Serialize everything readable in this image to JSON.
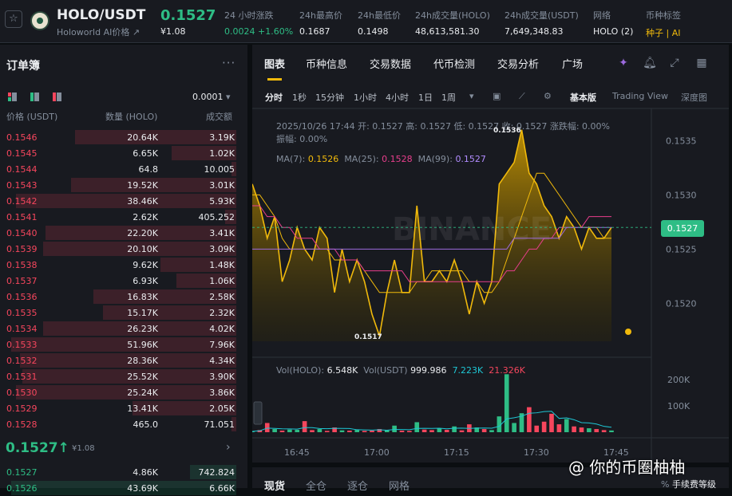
{
  "header": {
    "pair": "HOLO/USDT",
    "pair_sub": "Holoworld AI价格",
    "last_price": "0.1527",
    "last_fiat": "¥1.08",
    "stats": [
      {
        "label": "24 小时涨跌",
        "value": "0.0024 +1.60%"
      },
      {
        "label": "24h最高价",
        "value": "0.1687"
      },
      {
        "label": "24h最低价",
        "value": "0.1498"
      },
      {
        "label": "24h成交量(HOLO)",
        "value": "48,613,581.30"
      },
      {
        "label": "24h成交量(USDT)",
        "value": "7,649,348.83"
      },
      {
        "label": "网络",
        "value": "HOLO (2)"
      },
      {
        "label": "币种标签",
        "value": "种子 | AI"
      }
    ]
  },
  "orderbook": {
    "title": "订单簿",
    "tick": "0.0001",
    "col_price": "价格 (USDT)",
    "col_qty": "数量 (HOLO)",
    "col_total": "成交额",
    "asks": [
      {
        "p": "0.1546",
        "q": "20.64K",
        "t": "3.19K",
        "depth": 0.7
      },
      {
        "p": "0.1545",
        "q": "6.65K",
        "t": "1.02K",
        "depth": 0.28
      },
      {
        "p": "0.1544",
        "q": "64.8",
        "t": "10.005",
        "depth": 0.02
      },
      {
        "p": "0.1543",
        "q": "19.52K",
        "t": "3.01K",
        "depth": 0.72
      },
      {
        "p": "0.1542",
        "q": "38.46K",
        "t": "5.93K",
        "depth": 0.96
      },
      {
        "p": "0.1541",
        "q": "2.62K",
        "t": "405.252",
        "depth": 0.05
      },
      {
        "p": "0.1540",
        "q": "22.20K",
        "t": "3.41K",
        "depth": 0.83
      },
      {
        "p": "0.1539",
        "q": "20.10K",
        "t": "3.09K",
        "depth": 0.84
      },
      {
        "p": "0.1538",
        "q": "9.62K",
        "t": "1.48K",
        "depth": 0.33
      },
      {
        "p": "0.1537",
        "q": "6.93K",
        "t": "1.06K",
        "depth": 0.26
      },
      {
        "p": "0.1536",
        "q": "16.83K",
        "t": "2.58K",
        "depth": 0.62
      },
      {
        "p": "0.1535",
        "q": "15.17K",
        "t": "2.32K",
        "depth": 0.58
      },
      {
        "p": "0.1534",
        "q": "26.23K",
        "t": "4.02K",
        "depth": 0.84
      },
      {
        "p": "0.1533",
        "q": "51.96K",
        "t": "7.96K",
        "depth": 0.98
      },
      {
        "p": "0.1532",
        "q": "28.36K",
        "t": "4.34K",
        "depth": 0.94
      },
      {
        "p": "0.1531",
        "q": "25.52K",
        "t": "3.90K",
        "depth": 0.93
      },
      {
        "p": "0.1530",
        "q": "25.24K",
        "t": "3.86K",
        "depth": 0.96
      },
      {
        "p": "0.1529",
        "q": "13.41K",
        "t": "2.05K",
        "depth": 0.45
      },
      {
        "p": "0.1528",
        "q": "465.0",
        "t": "71.051",
        "depth": 0.02
      }
    ],
    "mid_price": "0.1527↑",
    "mid_fiat": "¥1.08",
    "bids": [
      {
        "p": "0.1527",
        "q": "4.86K",
        "t": "742.824",
        "depth": 0.2
      },
      {
        "p": "0.1526",
        "q": "43.69K",
        "t": "6.66K",
        "depth": 0.98
      }
    ]
  },
  "chart_panel": {
    "tabs": [
      "图表",
      "币种信息",
      "交易数据",
      "代币检测",
      "交易分析",
      "广场"
    ],
    "timeframes": [
      "分时",
      "1秒",
      "15分钟",
      "1小时",
      "4小时",
      "1日",
      "1周"
    ],
    "views": [
      "基本版",
      "Trading View",
      "深度图"
    ],
    "ohlc_line": "2025/10/26 17:44 开: 0.1527 高: 0.1527 低: 0.1527 收: 0.1527 涨跌幅: 0.00%",
    "ohlc_line2": "振幅: 0.00%",
    "ma_line": {
      "ma7_label": "MA(7):",
      "ma7": "0.1526",
      "ma25_label": "MA(25):",
      "ma25": "0.1528",
      "ma99_label": "MA(99):",
      "ma99": "0.1527"
    },
    "vol_line": {
      "label": "Vol(HOLO):",
      "holo": "6.548K",
      "usdt_label": "Vol(USDT)",
      "usdt": "999.986",
      "v1": "7.223K",
      "v2": "21.326K"
    },
    "current_price": "0.1527",
    "high_marker": "0.1536",
    "low_marker": "0.1517",
    "watermark": "BINANCE"
  },
  "chart_data": {
    "type": "area",
    "y_ticks": [
      "0.1535",
      "0.1530",
      "0.1525",
      "0.1520"
    ],
    "y_range": [
      0.15165,
      0.15365
    ],
    "x_ticks": [
      "16:45",
      "17:00",
      "17:15",
      "17:30",
      "17:45"
    ],
    "price": [
      0.1531,
      0.1529,
      0.1526,
      0.1528,
      0.1522,
      0.1524,
      0.1527,
      0.1525,
      0.1524,
      0.1527,
      0.1526,
      0.1521,
      0.1525,
      0.1522,
      0.1524,
      0.1522,
      0.1519,
      0.1517,
      0.1521,
      0.1524,
      0.1521,
      0.1521,
      0.1529,
      0.1522,
      0.1522,
      0.1523,
      0.1522,
      0.1524,
      0.1522,
      0.1519,
      0.1522,
      0.152,
      0.1522,
      0.1531,
      0.1532,
      0.1533,
      0.1536,
      0.1532,
      0.1531,
      0.1529,
      0.1528,
      0.1526,
      0.1528,
      0.1527,
      0.1525,
      0.1527,
      0.1526,
      0.1526,
      0.1527
    ],
    "ma7": [
      0.153,
      0.153,
      0.1529,
      0.1528,
      0.1526,
      0.1525,
      0.1525,
      0.1525,
      0.1525,
      0.1525,
      0.1525,
      0.1524,
      0.1524,
      0.1524,
      0.1524,
      0.1523,
      0.1522,
      0.1521,
      0.1521,
      0.1521,
      0.1521,
      0.1521,
      0.1522,
      0.1522,
      0.1523,
      0.1523,
      0.1523,
      0.1523,
      0.1523,
      0.1522,
      0.1522,
      0.1521,
      0.1521,
      0.1522,
      0.1524,
      0.1526,
      0.1528,
      0.153,
      0.1532,
      0.1532,
      0.1531,
      0.153,
      0.1529,
      0.1528,
      0.1527,
      0.1527,
      0.1527,
      0.1526,
      0.1526
    ],
    "ma25": [
      0.1529,
      0.1529,
      0.1528,
      0.1528,
      0.1527,
      0.1527,
      0.1526,
      0.1526,
      0.1526,
      0.1525,
      0.1525,
      0.1525,
      0.1524,
      0.1524,
      0.1524,
      0.1523,
      0.1523,
      0.1523,
      0.1523,
      0.1523,
      0.1523,
      0.1522,
      0.1522,
      0.1522,
      0.1522,
      0.1522,
      0.1522,
      0.1522,
      0.1522,
      0.1522,
      0.1522,
      0.1522,
      0.1522,
      0.1522,
      0.1523,
      0.1523,
      0.1524,
      0.1525,
      0.1525,
      0.1526,
      0.1526,
      0.1527,
      0.1527,
      0.1527,
      0.1527,
      0.1528,
      0.1528,
      0.1528,
      0.1528
    ],
    "ma99": [
      0.1525,
      0.1525,
      0.1525,
      0.1525,
      0.1525,
      0.1525,
      0.1525,
      0.1525,
      0.1525,
      0.1525,
      0.1525,
      0.1525,
      0.1525,
      0.1525,
      0.1525,
      0.1525,
      0.1525,
      0.1525,
      0.1525,
      0.1525,
      0.1525,
      0.1525,
      0.1525,
      0.1525,
      0.1525,
      0.1525,
      0.1525,
      0.1525,
      0.1525,
      0.1525,
      0.1525,
      0.1525,
      0.1525,
      0.1525,
      0.1525,
      0.1526,
      0.1526,
      0.1526,
      0.1526,
      0.1526,
      0.1526,
      0.1526,
      0.1527,
      0.1527,
      0.1527,
      0.1527,
      0.1527,
      0.1527,
      0.1527
    ],
    "volume_ticks": [
      "200K",
      "100K"
    ],
    "volume_range": [
      0,
      230000
    ],
    "volume": [
      3000,
      8000,
      35000,
      12000,
      6000,
      10000,
      9000,
      42000,
      8000,
      12000,
      5000,
      18000,
      7000,
      6000,
      9000,
      5000,
      6000,
      12000,
      8000,
      25000,
      6000,
      5000,
      38000,
      10000,
      8000,
      14000,
      9000,
      22000,
      7000,
      30000,
      18000,
      12000,
      8000,
      60000,
      220000,
      35000,
      72000,
      95000,
      25000,
      40000,
      70000,
      30000,
      50000,
      22000,
      18000,
      15000,
      12000,
      8000,
      6500
    ],
    "volume_up": [
      true,
      false,
      false,
      true,
      false,
      true,
      true,
      false,
      false,
      true,
      false,
      false,
      true,
      false,
      true,
      false,
      false,
      false,
      true,
      true,
      false,
      false,
      true,
      false,
      false,
      true,
      false,
      true,
      false,
      false,
      true,
      false,
      true,
      true,
      true,
      true,
      true,
      false,
      false,
      false,
      false,
      false,
      true,
      false,
      false,
      true,
      false,
      false,
      true
    ]
  },
  "bottom_tabs": [
    "现货",
    "全仓",
    "逐仓",
    "网格"
  ],
  "fee_label": "手续费等级",
  "overlay_watermark": "@ 你的币圈柚柚",
  "colors": {
    "up": "#2ebd85",
    "down": "#f6465d",
    "accent": "#f0b90b",
    "ma7": "#f0b90b",
    "ma25": "#e83e8c",
    "ma99": "#9c6ade"
  }
}
